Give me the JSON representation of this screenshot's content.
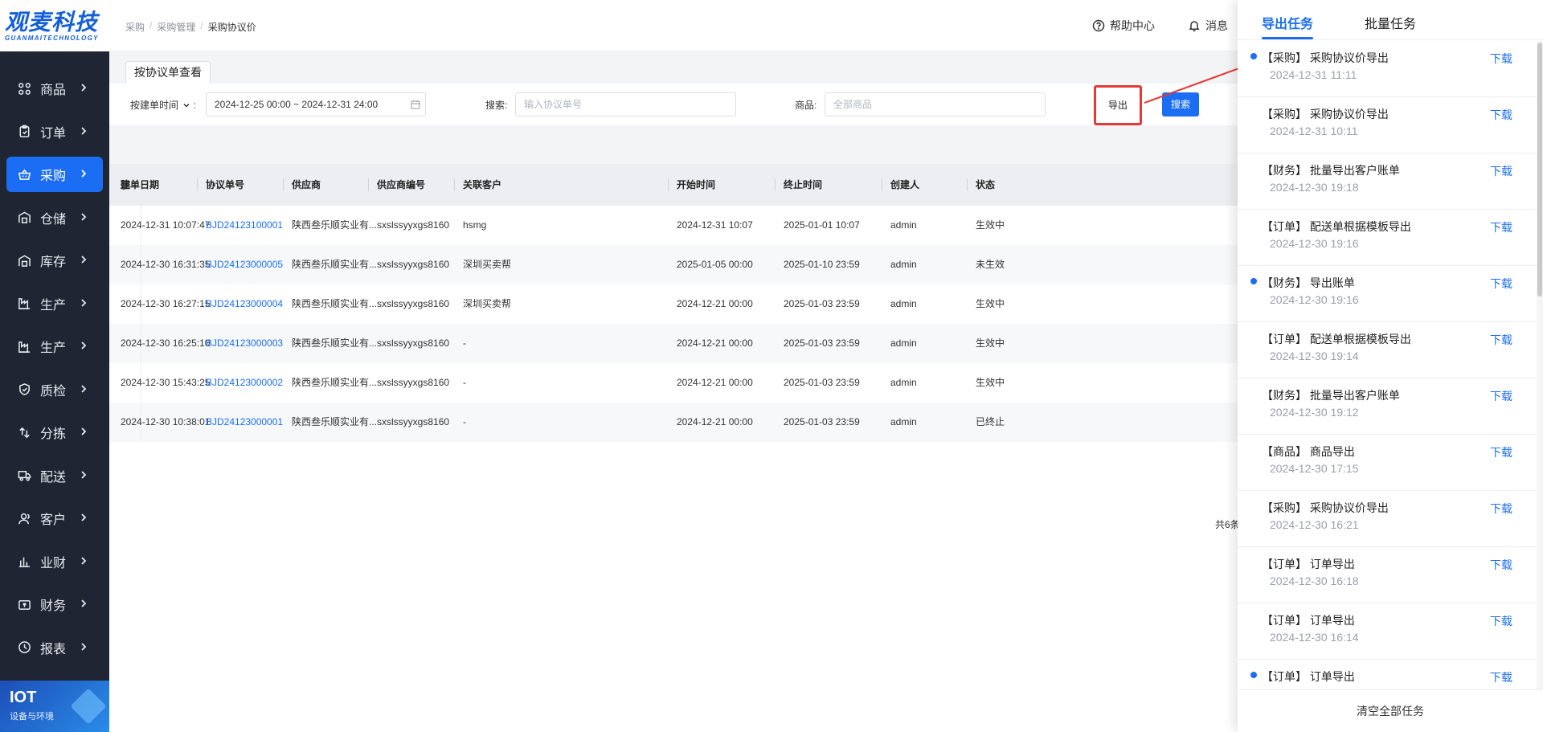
{
  "logo": {
    "main": "观麦科技",
    "sub": "GUANMAITECHNOLOGY"
  },
  "sidebar": {
    "items": [
      {
        "label": "商品",
        "icon": "grid-icon"
      },
      {
        "label": "订单",
        "icon": "clipboard-icon"
      },
      {
        "label": "采购",
        "icon": "basket-icon",
        "active": true
      },
      {
        "label": "仓储",
        "icon": "warehouse-icon"
      },
      {
        "label": "库存",
        "icon": "warehouse-icon"
      },
      {
        "label": "生产",
        "icon": "factory-icon"
      },
      {
        "label": "生产",
        "icon": "factory-icon"
      },
      {
        "label": "质检",
        "icon": "shield-icon"
      },
      {
        "label": "分拣",
        "icon": "sort-icon"
      },
      {
        "label": "配送",
        "icon": "truck-icon"
      },
      {
        "label": "客户",
        "icon": "user-icon"
      },
      {
        "label": "业财",
        "icon": "bar-chart-icon"
      },
      {
        "label": "财务",
        "icon": "finance-icon"
      },
      {
        "label": "报表",
        "icon": "clock-icon"
      }
    ],
    "iot": {
      "title": "IOT",
      "sub": "设备与环境"
    }
  },
  "header": {
    "breadcrumb": [
      "采购",
      "采购管理",
      "采购协议价"
    ],
    "help": "帮助中心",
    "message": "消息"
  },
  "tabs": {
    "view": "按协议单查看"
  },
  "filters": {
    "time_type": "按建单时间",
    "colon": ":",
    "date_range": "2024-12-25 00:00 ~ 2024-12-31 24:00",
    "search_label": "搜索:",
    "search_placeholder": "输入协议单号",
    "goods_label": "商品:",
    "goods_placeholder": "全部商品",
    "search_button": "搜索",
    "export_button": "导出"
  },
  "table": {
    "columns": [
      "建单日期",
      "协议单号",
      "供应商",
      "供应商编号",
      "关联客户",
      "开始时间",
      "终止时间",
      "创建人",
      "状态"
    ],
    "rows": [
      [
        "2024-12-31 10:07:47",
        "BJD24123100001",
        "陕西叁乐顺实业有...",
        "sxslssyyxgs8160",
        "hsmg",
        "2024-12-31 10:07",
        "2025-01-01 10:07",
        "admin",
        "生效中"
      ],
      [
        "2024-12-30 16:31:35",
        "BJD24123000005",
        "陕西叁乐顺实业有...",
        "sxslssyyxgs8160",
        "深圳买卖帮",
        "2025-01-05 00:00",
        "2025-01-10 23:59",
        "admin",
        "未生效"
      ],
      [
        "2024-12-30 16:27:15",
        "BJD24123000004",
        "陕西叁乐顺实业有...",
        "sxslssyyxgs8160",
        "深圳买卖帮",
        "2024-12-21 00:00",
        "2025-01-03 23:59",
        "admin",
        "生效中"
      ],
      [
        "2024-12-30 16:25:10",
        "BJD24123000003",
        "陕西叁乐顺实业有...",
        "sxslssyyxgs8160",
        "-",
        "2024-12-21 00:00",
        "2025-01-03 23:59",
        "admin",
        "生效中"
      ],
      [
        "2024-12-30 15:43:25",
        "BJD24123000002",
        "陕西叁乐顺实业有...",
        "sxslssyyxgs8160",
        "-",
        "2024-12-21 00:00",
        "2025-01-03 23:59",
        "admin",
        "生效中"
      ],
      [
        "2024-12-30 10:38:01",
        "BJD24123000001",
        "陕西叁乐顺实业有...",
        "sxslssyyxgs8160",
        "-",
        "2024-12-21 00:00",
        "2025-01-03 23:59",
        "admin",
        "已终止"
      ]
    ],
    "pager": "共6条"
  },
  "panel": {
    "tab_export": "导出任务",
    "tab_batch": "批量任务",
    "download_label": "下载",
    "tasks": [
      {
        "name": "【采购】 采购协议价导出",
        "time": "2024-12-31 11:11",
        "dot": true
      },
      {
        "name": "【采购】 采购协议价导出",
        "time": "2024-12-31 10:11",
        "dot": false
      },
      {
        "name": "【财务】 批量导出客户账单",
        "time": "2024-12-30 19:18",
        "dot": false
      },
      {
        "name": "【订单】 配送单根据模板导出",
        "time": "2024-12-30 19:16",
        "dot": false
      },
      {
        "name": "【财务】 导出账单",
        "time": "2024-12-30 19:16",
        "dot": true
      },
      {
        "name": "【订单】 配送单根据模板导出",
        "time": "2024-12-30 19:14",
        "dot": false
      },
      {
        "name": "【财务】 批量导出客户账单",
        "time": "2024-12-30 19:12",
        "dot": false
      },
      {
        "name": "【商品】 商品导出",
        "time": "2024-12-30 17:15",
        "dot": false
      },
      {
        "name": "【采购】 采购协议价导出",
        "time": "2024-12-30 16:21",
        "dot": false
      },
      {
        "name": "【订单】 订单导出",
        "time": "2024-12-30 16:18",
        "dot": false
      },
      {
        "name": "【订单】 订单导出",
        "time": "2024-12-30 16:14",
        "dot": false
      },
      {
        "name": "【订单】 订单导出",
        "time": "",
        "dot": true
      }
    ],
    "clear_all": "清空全部任务"
  },
  "colors": {
    "accent": "#1b6ef3",
    "sidebar_bg": "#1f2533",
    "highlight": "#e53935"
  }
}
